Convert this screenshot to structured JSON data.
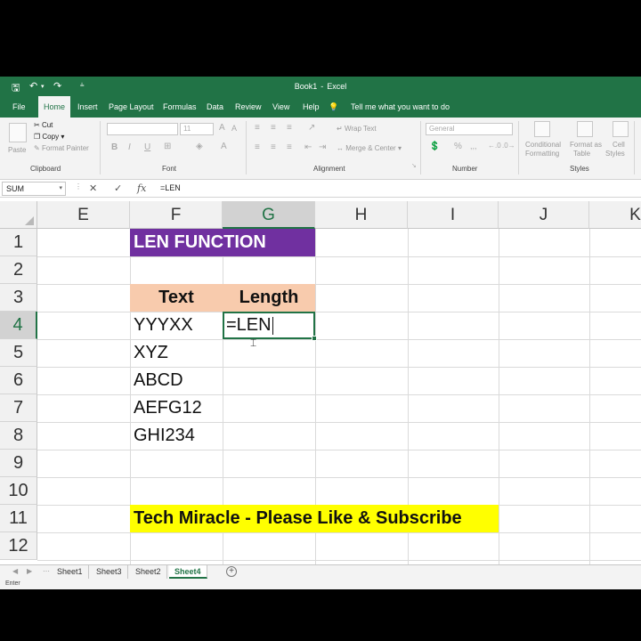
{
  "app": {
    "doc_name": "Book1",
    "separator": "-",
    "app_name": "Excel"
  },
  "ribbon": {
    "tabs": [
      "File",
      "Home",
      "Insert",
      "Page Layout",
      "Formulas",
      "Data",
      "Review",
      "View",
      "Help"
    ],
    "active_tab": "Home",
    "tell_me": "Tell me what you want to do",
    "clipboard": {
      "paste": "Paste",
      "cut": "Cut",
      "copy": "Copy",
      "format_painter": "Format Painter",
      "label": "Clipboard"
    },
    "font": {
      "size": "11",
      "bold": "B",
      "italic": "I",
      "underline": "U",
      "label": "Font"
    },
    "alignment": {
      "wrap_text": "Wrap Text",
      "merge_center": "Merge & Center",
      "label": "Alignment"
    },
    "number": {
      "format": "General",
      "percent": "%",
      "label": "Number"
    },
    "styles": {
      "conditional_1": "Conditional",
      "conditional_2": "Formatting",
      "format_as_1": "Format as",
      "format_as_2": "Table",
      "cell_1": "Cell",
      "cell_2": "Styles",
      "label": "Styles"
    }
  },
  "formula_bar": {
    "name_box": "SUM",
    "cancel": "✕",
    "enter": "✓",
    "fx": "fx",
    "formula": "=LEN"
  },
  "grid": {
    "columns": [
      "E",
      "F",
      "G",
      "H",
      "I",
      "J",
      "K"
    ],
    "selected_column": "G",
    "rows": [
      "1",
      "2",
      "3",
      "4",
      "5",
      "6",
      "7",
      "8",
      "9",
      "10",
      "11",
      "12"
    ],
    "selected_row": "4",
    "cells": {
      "F1": "LEN FUNCTION",
      "F3": "Text",
      "G3": "Length",
      "F4": "YYYXX",
      "G4": "=LEN",
      "F5": "XYZ",
      "F6": "ABCD",
      "F7": "AEFG12",
      "F8": "GHI234",
      "F11": "Tech Miracle - Please Like & Subscribe"
    },
    "colors": {
      "title_fill": "#7030a0",
      "header_fill": "#f8cbad",
      "banner_fill": "#ffff00",
      "accent": "#217346"
    }
  },
  "sheets": {
    "tabs": [
      "Sheet1",
      "Sheet3",
      "Sheet2",
      "Sheet4"
    ],
    "active": "Sheet4",
    "add_icon": "+"
  },
  "status": {
    "mode": "Enter"
  }
}
